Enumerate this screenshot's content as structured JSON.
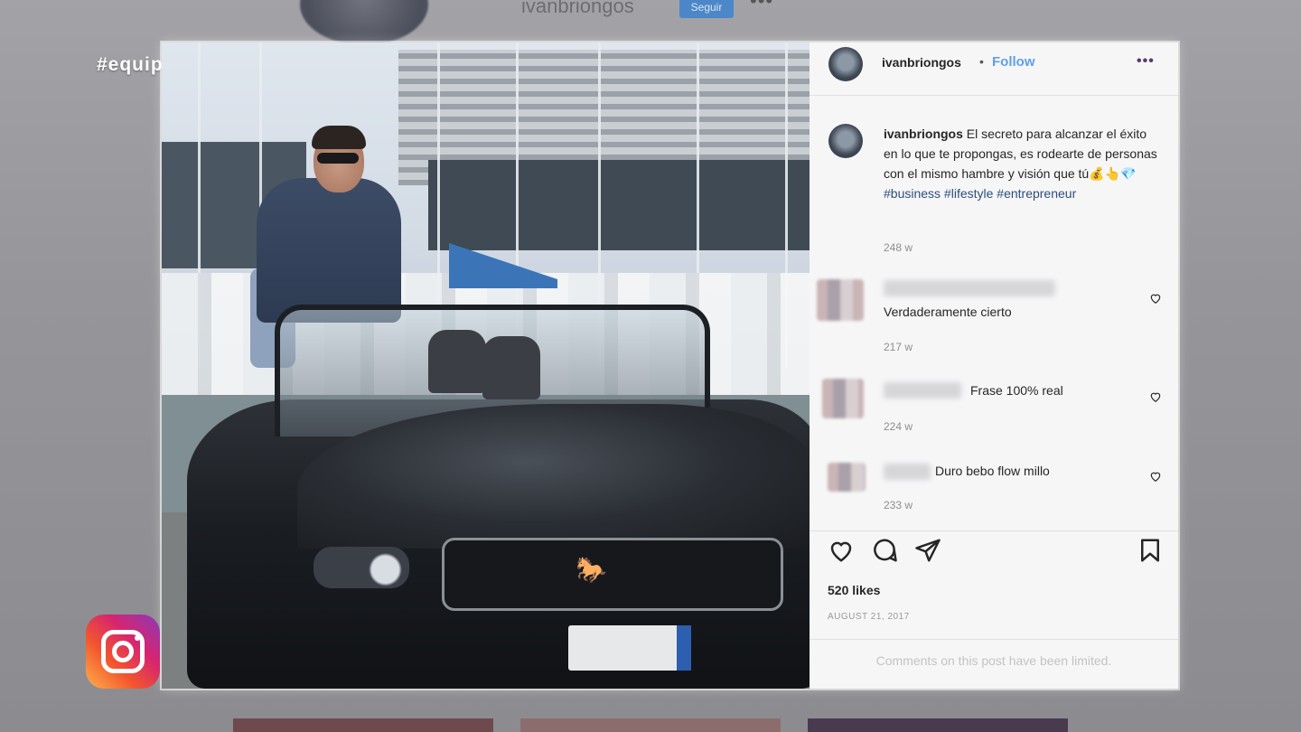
{
  "overlay": {
    "hashtag": "#equipoacademia"
  },
  "background_profile": {
    "username": "ivanbriongos",
    "follow_label": "Seguir",
    "more": "•••"
  },
  "post": {
    "header": {
      "username": "ivanbriongos",
      "separator": "•",
      "follow_label": "Follow",
      "more": "•••"
    },
    "caption": {
      "username": "ivanbriongos",
      "text": "El secreto para alcanzar el éxito en lo que te propongas, es rodearte de personas con el mismo hambre y visión que tú💰👆💎",
      "hashtags": "#business #lifestyle #entrepreneur",
      "time": "248 w"
    },
    "comments": [
      {
        "text": "Verdaderamente cierto",
        "time": "217 w"
      },
      {
        "text": "Frase 100% real",
        "time": "224 w"
      },
      {
        "text": "Duro bebo flow millo",
        "time": "233 w"
      }
    ],
    "likes": "520 likes",
    "date": "AUGUST 21, 2017",
    "comments_limited": "Comments on this post have been limited.",
    "icons": {
      "like": "heart-icon",
      "comment": "comment-icon",
      "share": "send-icon",
      "save": "bookmark-icon"
    }
  },
  "colors": {
    "follow_blue": "#5ea0e8",
    "hashtag_blue": "#2c4f7c",
    "panel_bg": "#f6f6f7"
  }
}
